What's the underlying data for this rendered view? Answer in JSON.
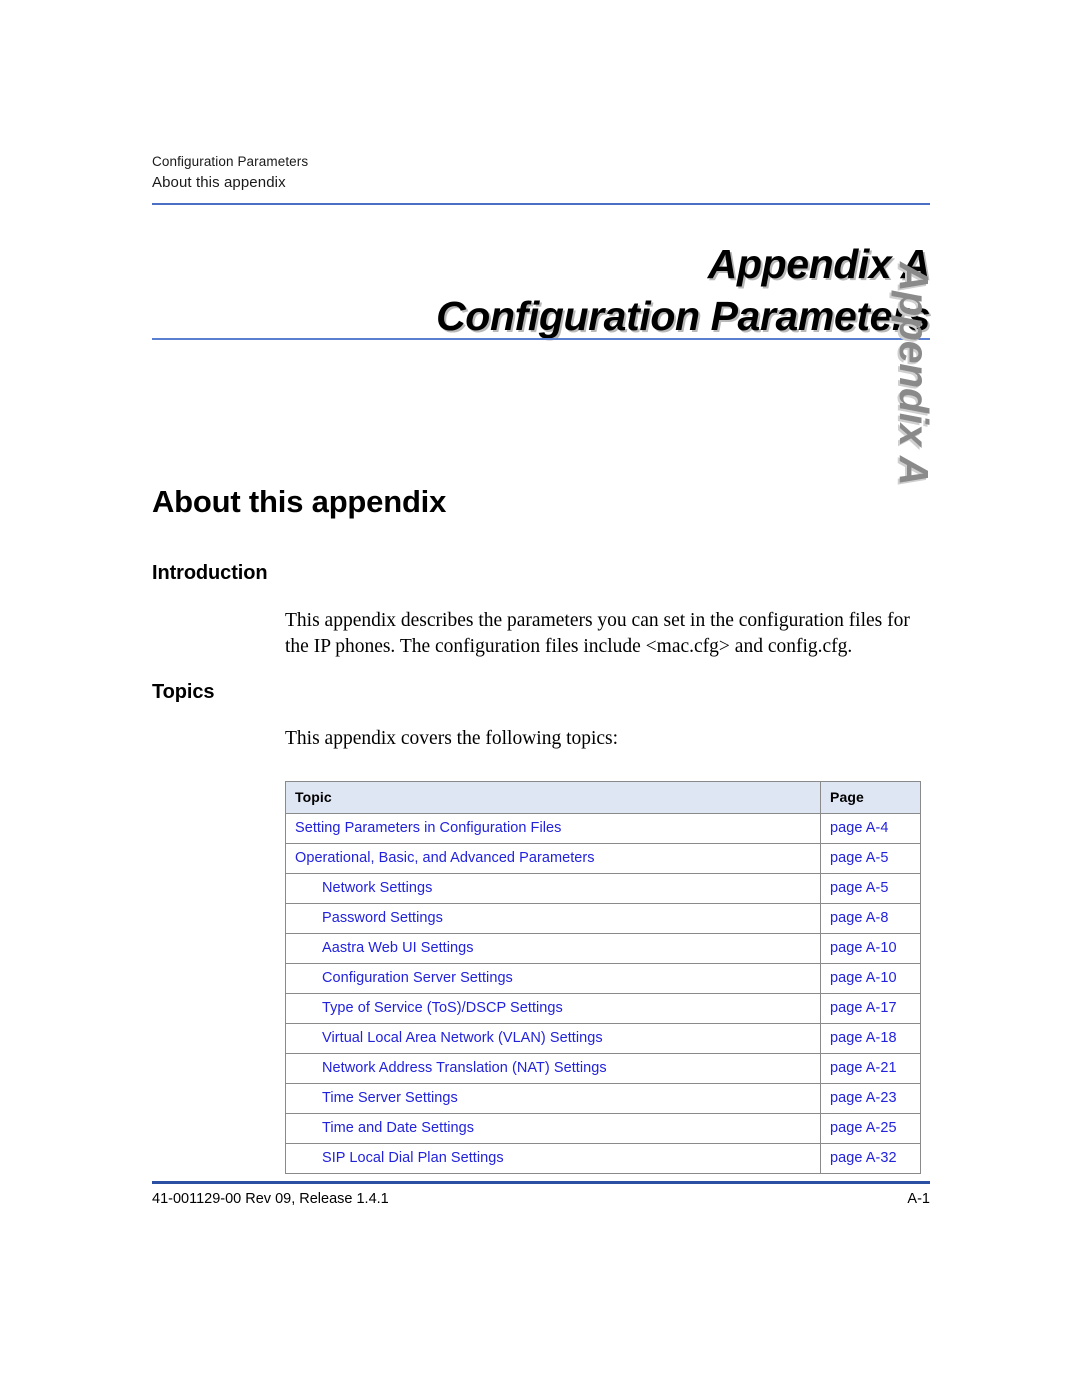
{
  "header": {
    "chapter_label": "Configuration Parameters",
    "section_label": "About this appendix"
  },
  "title": {
    "line1": "Appendix A",
    "line2": "Configuration Parameters",
    "side_tab": "Appendix A"
  },
  "sections": {
    "about_heading": "About this appendix",
    "introduction_heading": "Introduction",
    "introduction_text": "This appendix describes the parameters you can set in the configuration files for the IP phones. The configuration files include <mac.cfg> and config.cfg.",
    "topics_heading": "Topics",
    "topics_intro": "This appendix covers the following topics:"
  },
  "topics_table": {
    "columns": [
      "Topic",
      "Page"
    ],
    "rows": [
      {
        "topic": "Setting Parameters in Configuration Files",
        "page": "page A-4",
        "indent": false
      },
      {
        "topic": "Operational, Basic, and Advanced Parameters",
        "page": "page A-5",
        "indent": false
      },
      {
        "topic": "Network Settings",
        "page": "page A-5",
        "indent": true
      },
      {
        "topic": "Password Settings",
        "page": "page A-8",
        "indent": true
      },
      {
        "topic": "Aastra Web UI Settings",
        "page": "page A-10",
        "indent": true
      },
      {
        "topic": "Configuration Server Settings",
        "page": "page A-10",
        "indent": true
      },
      {
        "topic": "Type of Service (ToS)/DSCP Settings",
        "page": "page A-17",
        "indent": true
      },
      {
        "topic": "Virtual Local Area Network (VLAN) Settings",
        "page": "page A-18",
        "indent": true
      },
      {
        "topic": "Network Address Translation (NAT) Settings",
        "page": "page A-21",
        "indent": true
      },
      {
        "topic": "Time Server Settings",
        "page": "page A-23",
        "indent": true
      },
      {
        "topic": "Time and Date Settings",
        "page": "page A-25",
        "indent": true
      },
      {
        "topic": "SIP Local Dial Plan Settings",
        "page": "page A-32",
        "indent": true
      }
    ]
  },
  "footer": {
    "left": "41-001129-00 Rev 09, Release 1.4.1",
    "right": "A-1"
  },
  "colors": {
    "header_rule": "#4a6fc4",
    "title_rule": "#5a7fd0",
    "footer_rule": "#2b4fa3",
    "link": "#2222dd",
    "table_header_bg": "#dfe6f3",
    "table_border": "#8a8a8a",
    "side_tab": "#8a8a8a"
  }
}
